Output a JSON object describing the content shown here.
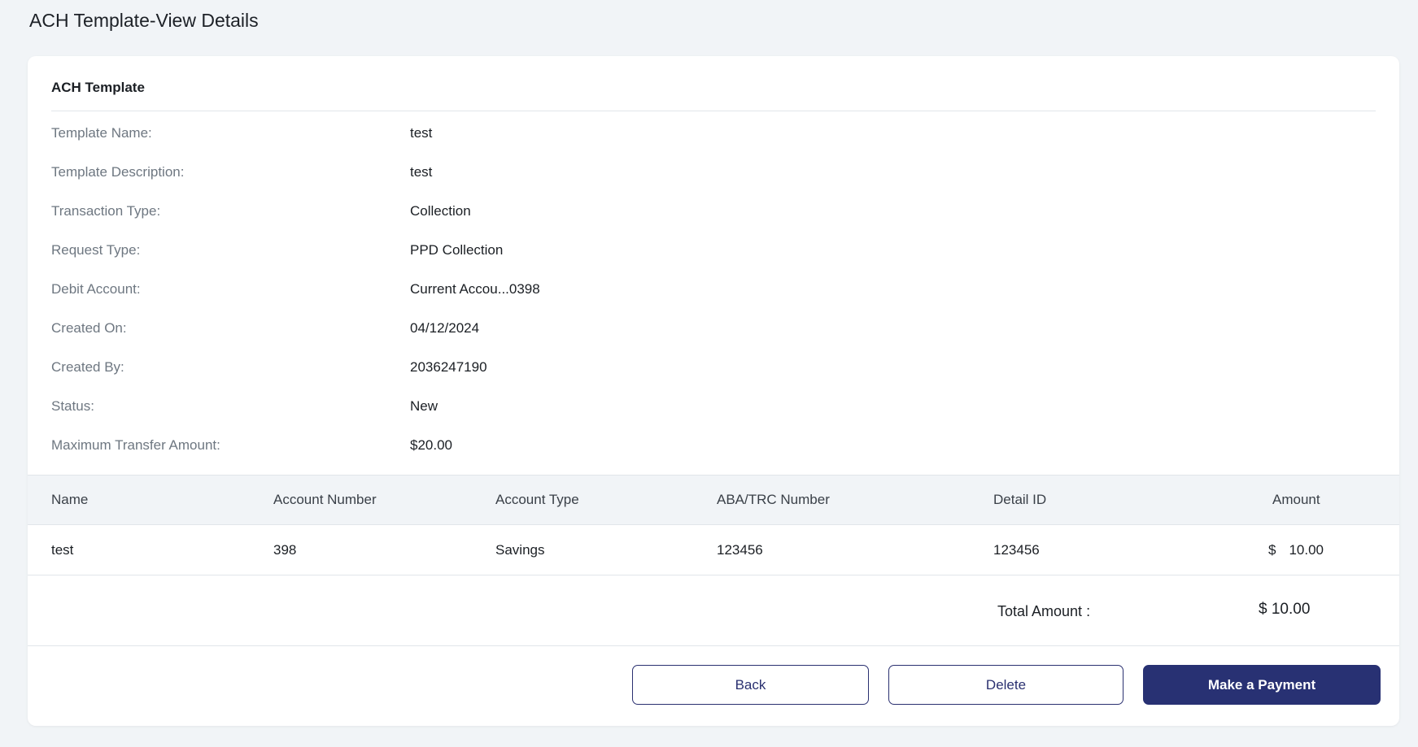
{
  "page": {
    "title": "ACH Template-View Details"
  },
  "card": {
    "title": "ACH Template"
  },
  "details": [
    {
      "label": "Template Name:",
      "value": "test"
    },
    {
      "label": "Template Description:",
      "value": "test"
    },
    {
      "label": "Transaction Type:",
      "value": "Collection"
    },
    {
      "label": "Request Type:",
      "value": "PPD Collection"
    },
    {
      "label": "Debit Account:",
      "value": "Current Accou...0398"
    },
    {
      "label": "Created On:",
      "value": "04/12/2024"
    },
    {
      "label": "Created By:",
      "value": "2036247190"
    },
    {
      "label": "Status:",
      "value": "New"
    },
    {
      "label": "Maximum Transfer Amount:",
      "value": "$20.00"
    }
  ],
  "table": {
    "headers": {
      "name": "Name",
      "account_number": "Account Number",
      "account_type": "Account Type",
      "aba": "ABA/TRC Number",
      "detail_id": "Detail ID",
      "amount": "Amount"
    },
    "rows": [
      {
        "name": "test",
        "account_number": "398",
        "account_type": "Savings",
        "aba": "123456",
        "detail_id": "123456",
        "currency": "$",
        "amount": "10.00"
      }
    ]
  },
  "total": {
    "label": "Total Amount  :",
    "value": "$ 10.00"
  },
  "actions": {
    "back": "Back",
    "delete": "Delete",
    "pay": "Make a Payment"
  },
  "colors": {
    "background": "#f1f4f7",
    "primary": "#283173",
    "label_text": "#6e7781"
  }
}
